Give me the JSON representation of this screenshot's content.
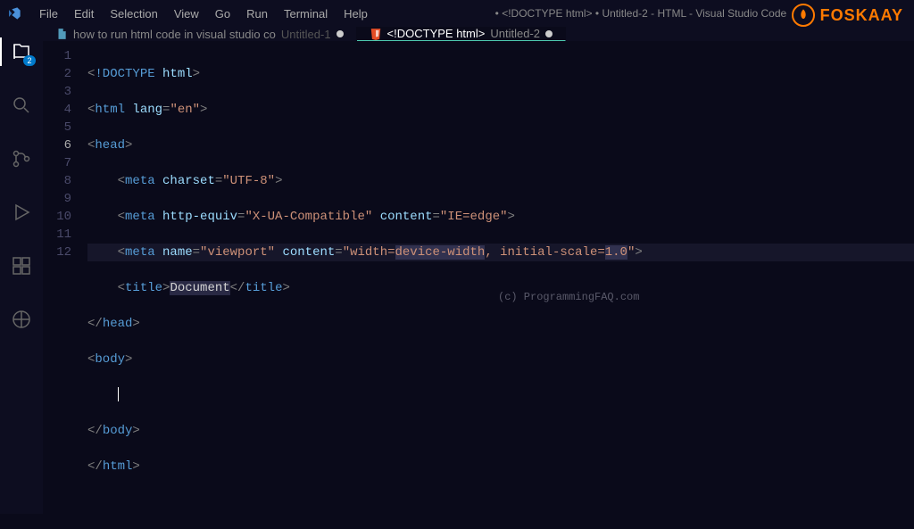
{
  "title": "• <!DOCTYPE html> • Untitled-2 - HTML - Visual Studio Code",
  "menu": [
    "File",
    "Edit",
    "Selection",
    "View",
    "Go",
    "Run",
    "Terminal",
    "Help"
  ],
  "brand": "FOSKAAY",
  "activitybar": {
    "explorer_badge": "2"
  },
  "tabs": [
    {
      "label": "how to run html code in visual studio co",
      "sub": "Untitled-1",
      "dirty": "●"
    },
    {
      "label": "<!DOCTYPE html>",
      "sub": "Untitled-2",
      "dirty": "●"
    }
  ],
  "gutter": [
    "1",
    "2",
    "3",
    "4",
    "5",
    "6",
    "7",
    "8",
    "9",
    "10",
    "11",
    "12"
  ],
  "active_line": "6",
  "code": {
    "l1": {
      "b1": "<",
      "dt": "!DOCTYPE",
      "sp": " ",
      "at": "html",
      "b2": ">"
    },
    "l2": {
      "b1": "<",
      "tg": "html",
      "sp": " ",
      "at": "lang",
      "eq": "=",
      "st": "\"en\"",
      "b2": ">"
    },
    "l3": {
      "b1": "<",
      "tg": "head",
      "b2": ">"
    },
    "l4": {
      "ind": "    ",
      "b1": "<",
      "tg": "meta",
      "sp": " ",
      "at": "charset",
      "eq": "=",
      "st": "\"UTF-8\"",
      "b2": ">"
    },
    "l5": {
      "ind": "    ",
      "b1": "<",
      "tg": "meta",
      "sp": " ",
      "at1": "http-equiv",
      "eq1": "=",
      "st1": "\"X-UA-Compatible\"",
      "sp2": " ",
      "at2": "content",
      "eq2": "=",
      "st2": "\"IE=edge\"",
      "b2": ">"
    },
    "l6": {
      "ind": "    ",
      "b1": "<",
      "tg": "meta",
      "sp": " ",
      "at1": "name",
      "eq1": "=",
      "st1": "\"viewport\"",
      "sp2": " ",
      "at2": "content",
      "eq2": "=",
      "st2_a": "\"width=",
      "st2_sel": "device-width",
      "st2_b": ", initial-scale=",
      "st2_sel2": "1.0",
      "st2_c": "\"",
      "b2": ">"
    },
    "l7": {
      "ind": "    ",
      "b1": "<",
      "tg": "title",
      "b2": ">",
      "tx": "Document",
      "b3": "</",
      "tg2": "title",
      "b4": ">"
    },
    "l8": {
      "b1": "</",
      "tg": "head",
      "b2": ">"
    },
    "l9": {
      "b1": "<",
      "tg": "body",
      "b2": ">"
    },
    "l10": {
      "ind": "    "
    },
    "l11": {
      "b1": "</",
      "tg": "body",
      "b2": ">"
    },
    "l12": {
      "b1": "</",
      "tg": "html",
      "b2": ">"
    }
  },
  "watermark": "(c) ProgrammingFAQ.com"
}
